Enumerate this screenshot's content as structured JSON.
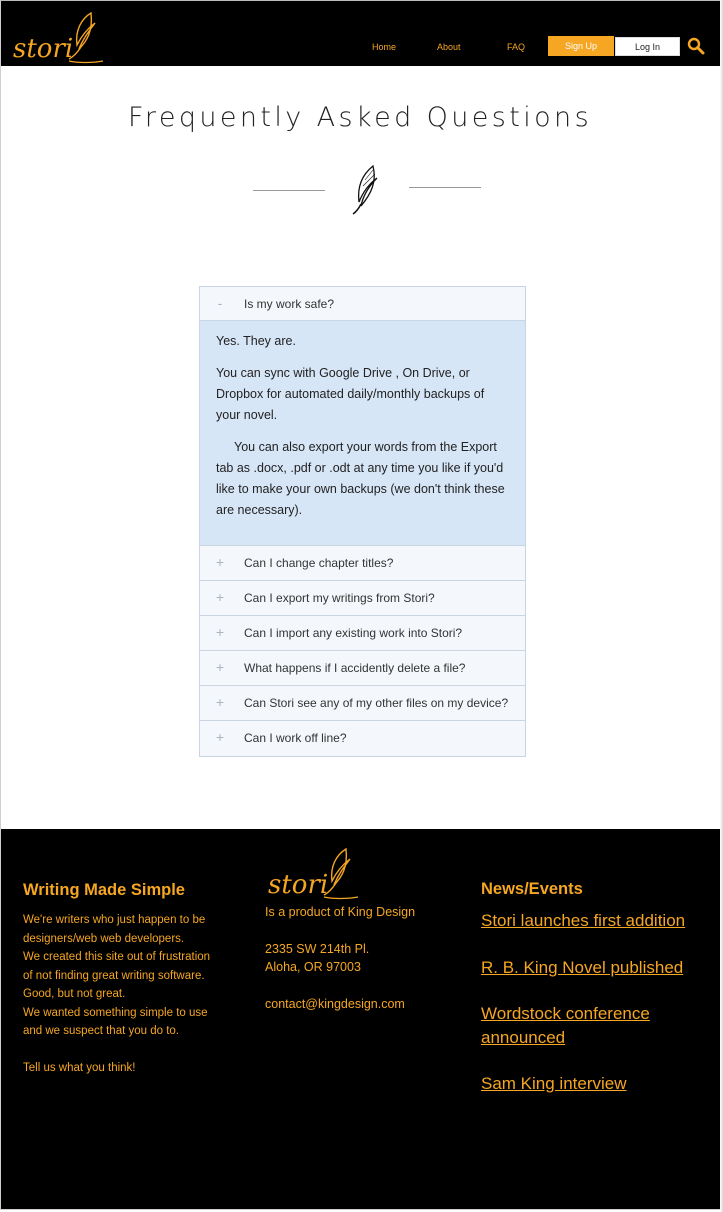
{
  "header": {
    "logo_text": "stori",
    "nav": {
      "home": "Home",
      "about": "About",
      "faq": "FAQ"
    },
    "signup_label": "Sign Up",
    "login_label": "Log In"
  },
  "page": {
    "title": "Frequently Asked Questions"
  },
  "faq": {
    "items": [
      {
        "toggle": "-",
        "question": "Is my work safe?",
        "answer": [
          "Yes. They are.",
          "You can sync with Google Drive , On Drive, or Dropbox for automated daily/monthly backups of your novel.",
          "You can also export your words from the Export tab as .docx, .pdf or .odt at any time you like if you'd like to make your own backups (we don't think these are necessary)."
        ]
      },
      {
        "toggle": "+",
        "question": "Can I change chapter titles?"
      },
      {
        "toggle": "+",
        "question": "Can I export my writings from Stori?"
      },
      {
        "toggle": "+",
        "question": "Can I import any existing work into Stori?"
      },
      {
        "toggle": "+",
        "question": "What happens if I accidently delete a file?"
      },
      {
        "toggle": "+",
        "question": "Can Stori see any of my other files on my device?"
      },
      {
        "toggle": "+",
        "question": "Can I work off line?"
      }
    ]
  },
  "footer": {
    "about": {
      "heading": "Writing Made Simple",
      "lines": [
        "We're writers who just happen to be designers/web web developers.",
        "We created this site out of frustration of not finding great writing software. Good, but not great.",
        "We wanted something simple to use and we suspect that you do to.",
        "Tell us what you think!"
      ]
    },
    "company": {
      "logo_text": "stori",
      "tagline": "Is a product of King Design",
      "address_line1": "2335 SW 214th Pl.",
      "address_line2": "Aloha, OR 97003",
      "email": "contact@kingdesign.com"
    },
    "news": {
      "heading": "News/Events",
      "links": [
        "Stori launches first addition",
        "R. B. King Novel published",
        "Wordstock conference announced",
        "Sam King interview"
      ]
    }
  },
  "colors": {
    "accent": "#f5a623",
    "header_bg": "#000000",
    "faq_bg": "#f4f8fc",
    "faq_open_bg": "#d7e6f7"
  }
}
